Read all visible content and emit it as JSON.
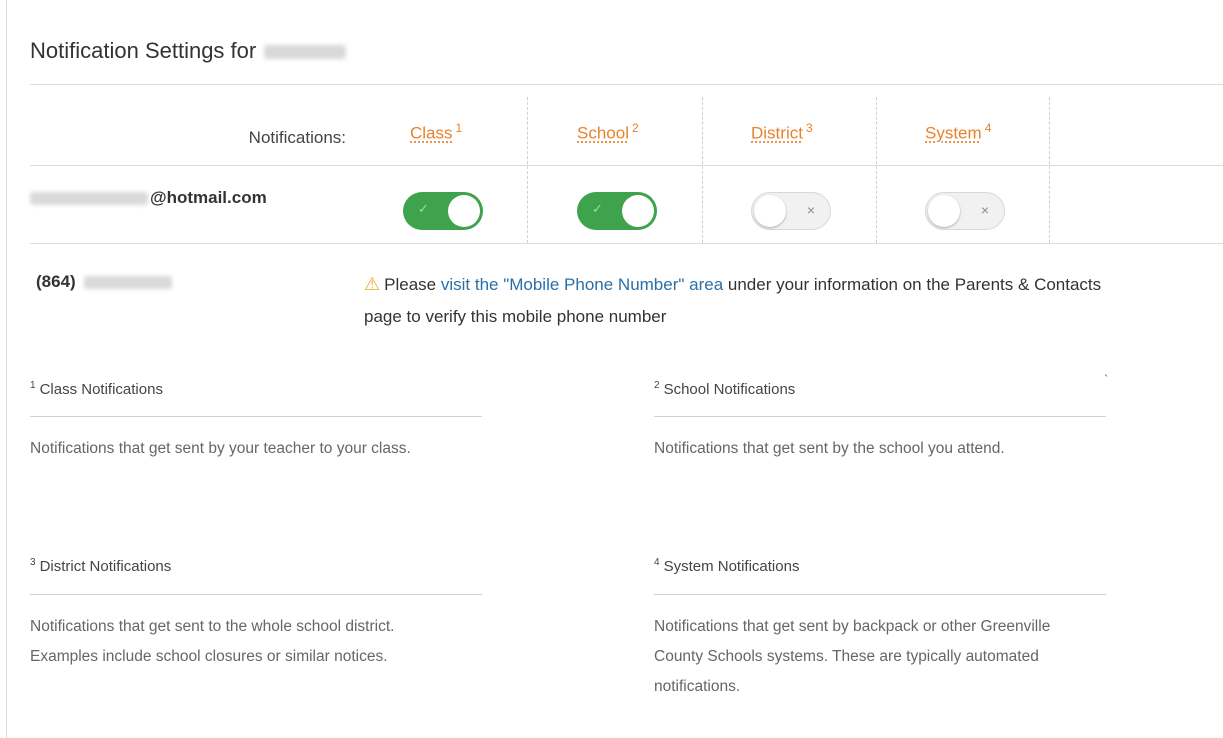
{
  "page": {
    "title": "Notification Settings for"
  },
  "table": {
    "notifications_label": "Notifications:",
    "columns": [
      {
        "label": "Class",
        "num": "1"
      },
      {
        "label": "School",
        "num": "2"
      },
      {
        "label": "District",
        "num": "3"
      },
      {
        "label": "System",
        "num": "4"
      }
    ],
    "email_suffix": "@hotmail.com",
    "toggles": [
      {
        "state": "on",
        "mark": "✓"
      },
      {
        "state": "on",
        "mark": "✓"
      },
      {
        "state": "off",
        "mark": "×"
      },
      {
        "state": "off",
        "mark": "×"
      }
    ],
    "phone_prefix": "(864)"
  },
  "warning": {
    "icon": "⚠",
    "before": "Please ",
    "link": "visit the \"Mobile Phone Number\" area",
    "after": " under your information on the Parents & Contacts page to verify this mobile phone number"
  },
  "footnotes": [
    {
      "num": "1",
      "title": "Class Notifications",
      "body": "Notifications that get sent by your teacher to your class."
    },
    {
      "num": "2",
      "title": "School Notifications",
      "body": "Notifications that get sent by the school you attend."
    },
    {
      "num": "3",
      "title": "District Notifications",
      "body": "Notifications that get sent to the whole school district. Examples include school closures or similar notices."
    },
    {
      "num": "4",
      "title": "System Notifications",
      "body": "Notifications that get sent by backpack or other Greenville County Schools systems. These are typically automated notifications."
    }
  ],
  "colors": {
    "accent_orange": "#e8822a",
    "toggle_on": "#3fa34d",
    "link_blue": "#2a6fa8",
    "warning_yellow": "#f0a626"
  },
  "stray_mark": "`"
}
